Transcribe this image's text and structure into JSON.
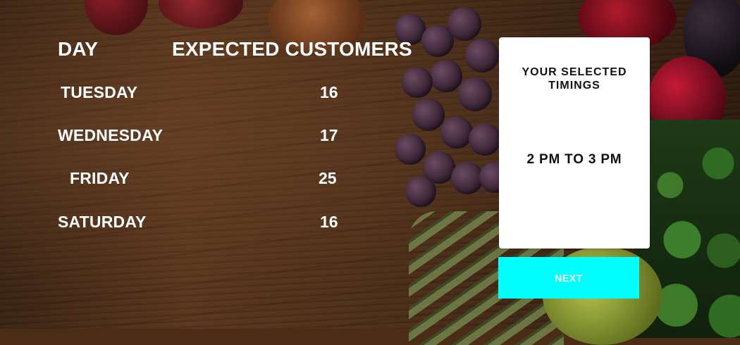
{
  "table": {
    "headers": {
      "day": "DAY",
      "expected_customers": "EXPECTED CUSTOMERS"
    },
    "rows": [
      {
        "day": "TUESDAY",
        "expected": "16"
      },
      {
        "day": "WEDNESDAY",
        "expected": "17"
      },
      {
        "day": "FRIDAY",
        "expected": "25"
      },
      {
        "day": "SATURDAY",
        "expected": "16"
      }
    ]
  },
  "selection_card": {
    "title": "YOUR SELECTED TIMINGS",
    "value": "2 PM TO 3 PM"
  },
  "actions": {
    "next_label": "NEXT"
  },
  "colors": {
    "accent_button": "#00ffff",
    "card_bg": "#ffffff",
    "text_light": "#ffffff",
    "text_dark": "#111111"
  }
}
